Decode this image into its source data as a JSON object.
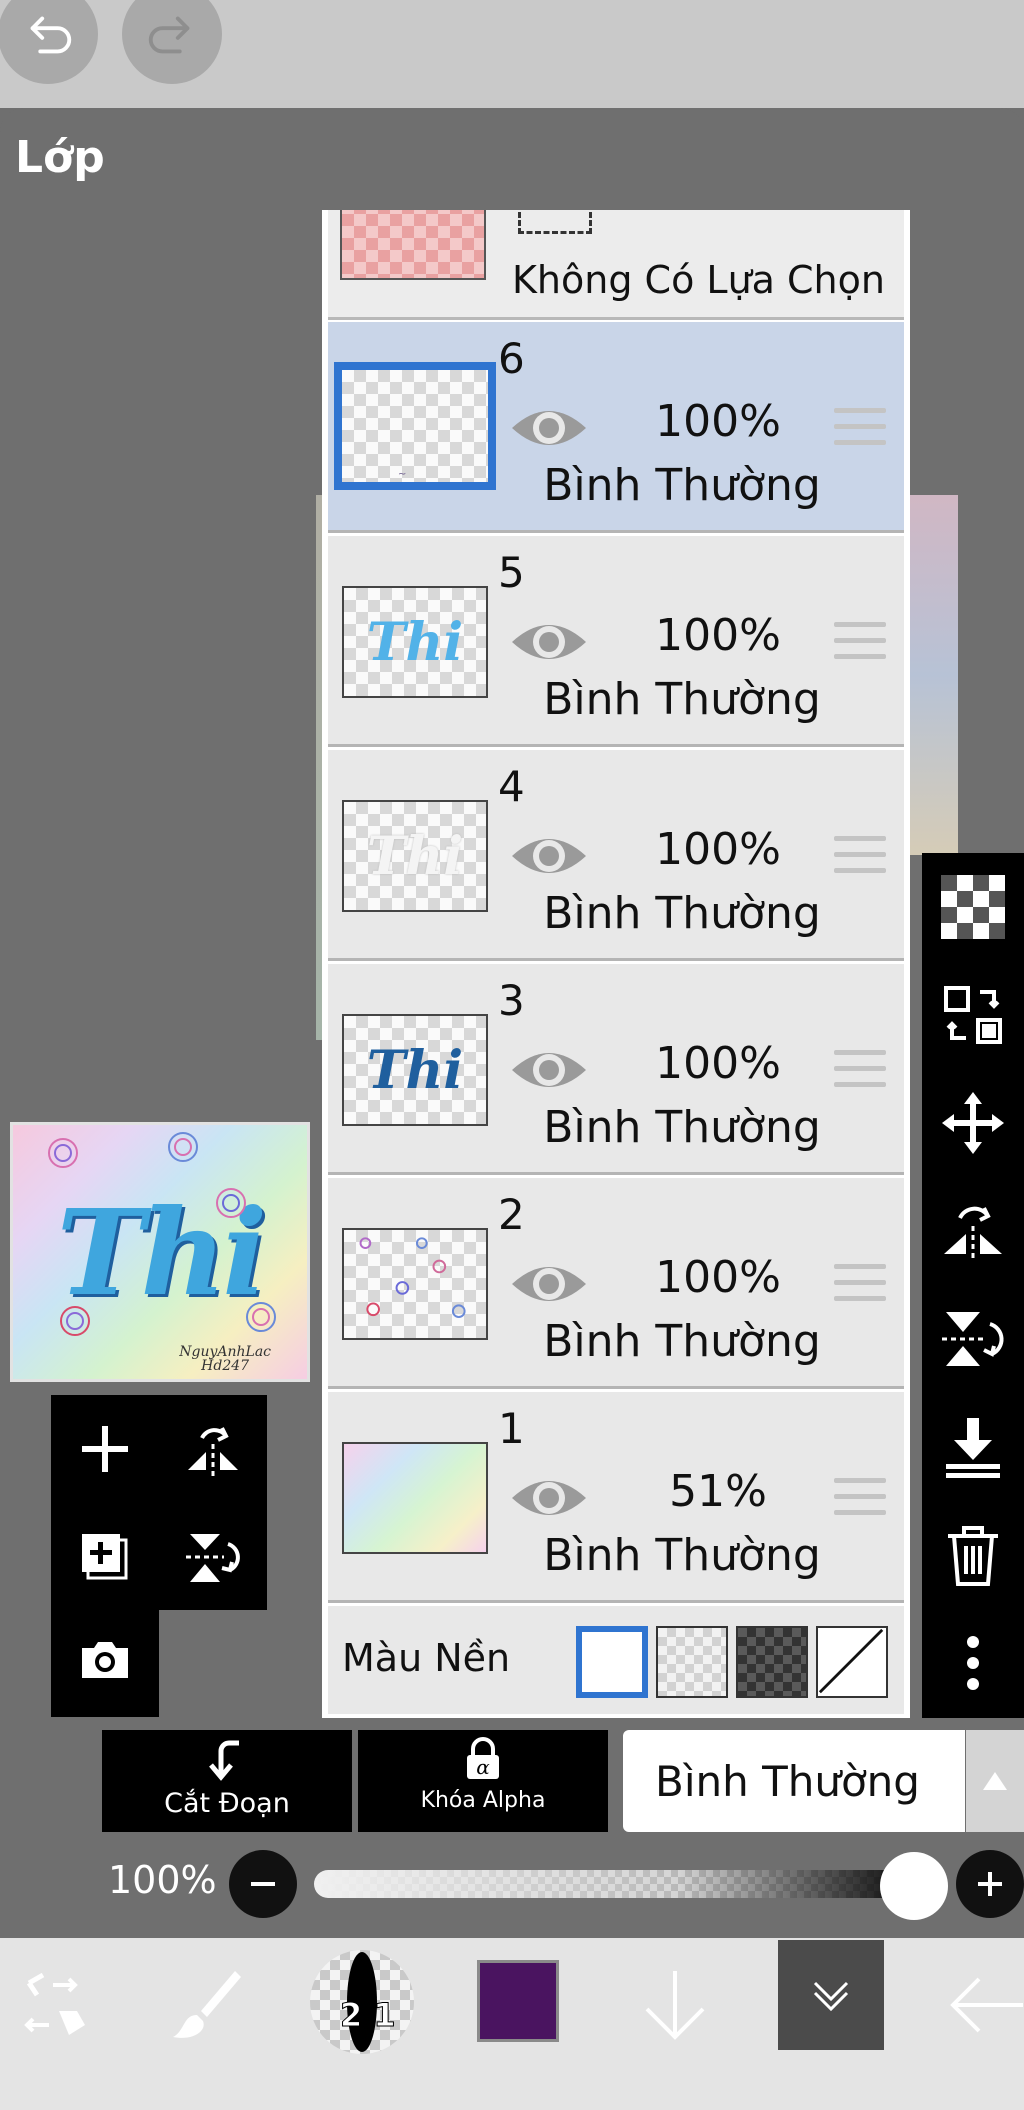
{
  "panel": {
    "title": "Lớp"
  },
  "partial_layer": {
    "label": "Không Có Lựa Chọn"
  },
  "layers": [
    {
      "number": "6",
      "opacity": "100%",
      "blend": "Bình Thường",
      "selected": true,
      "thumb": ""
    },
    {
      "number": "5",
      "opacity": "100%",
      "blend": "Bình Thường",
      "selected": false,
      "thumb": "Thi"
    },
    {
      "number": "4",
      "opacity": "100%",
      "blend": "Bình Thường",
      "selected": false,
      "thumb": "Thi"
    },
    {
      "number": "3",
      "opacity": "100%",
      "blend": "Bình Thường",
      "selected": false,
      "thumb": "Thi"
    },
    {
      "number": "2",
      "opacity": "100%",
      "blend": "Bình Thường",
      "selected": false,
      "thumb": ""
    },
    {
      "number": "1",
      "opacity": "51%",
      "blend": "Bình Thường",
      "selected": false,
      "thumb": ""
    }
  ],
  "background_row": {
    "label": "Màu Nền",
    "selected_swatch": "white"
  },
  "preview": {
    "text": "Thi",
    "signature_line1": "NguyAnhLac",
    "signature_line2": "Hd247"
  },
  "clipping": {
    "label": "Cắt Đoạn"
  },
  "alpha_lock": {
    "label": "Khóa Alpha"
  },
  "blend_select": {
    "value": "Bình Thường"
  },
  "opacity_slider": {
    "label": "100%",
    "value": 1.0
  },
  "brush": {
    "size_label": "2 1"
  },
  "colors": {
    "current": "#4a1460",
    "selection_blue": "#2f74d0"
  },
  "icons": {
    "undo": "undo-icon",
    "redo": "redo-icon",
    "eye": "eye-icon",
    "handle": "drag-handle-icon",
    "toolbar": [
      "checkerboard-icon",
      "transform-layer-icon",
      "move-icon",
      "flip-horizontal-icon",
      "flip-vertical-icon",
      "merge-down-icon",
      "trash-icon",
      "more-icon"
    ],
    "left": [
      "add-layer-icon",
      "flip-h-icon",
      "add-folder-icon",
      "flip-v-icon",
      "camera-icon"
    ],
    "bottom": [
      "transform-tool-icon",
      "brush-icon",
      "arrow-down-icon",
      "layers-menu-icon",
      "back-arrow-icon"
    ]
  }
}
